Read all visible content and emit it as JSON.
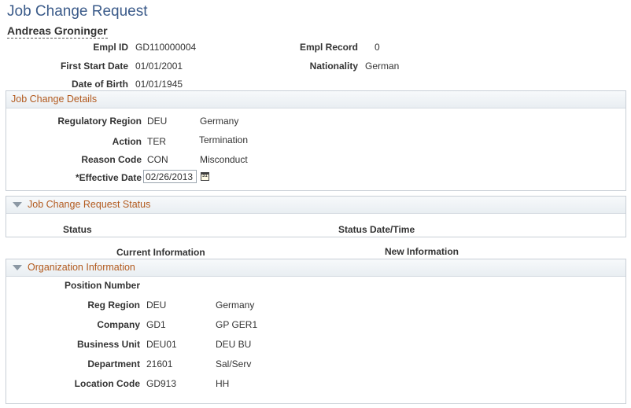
{
  "page": {
    "title": "Job Change Request",
    "person_name": "Andreas Groninger"
  },
  "employee": {
    "empl_id_label": "Empl ID",
    "empl_id": "GD110000004",
    "empl_record_label": "Empl Record",
    "empl_record": "0",
    "first_start_label": "First Start Date",
    "first_start": "01/01/2001",
    "nationality_label": "Nationality",
    "nationality": "German",
    "dob_label": "Date of Birth",
    "dob": "01/01/1945"
  },
  "job_change": {
    "title": "Job Change Details",
    "reg_region_label": "Regulatory Region",
    "reg_region_code": "DEU",
    "reg_region_desc": "Germany",
    "action_label": "Action",
    "action_code": "TER",
    "action_desc": "Termination",
    "reason_label": "Reason Code",
    "reason_code": "CON",
    "reason_desc": "Misconduct",
    "effective_label": "*Effective Date",
    "effective_date": "02/26/2013"
  },
  "status_section": {
    "title": "Job Change Request Status",
    "status_col": "Status",
    "status_date_col": "Status Date/Time"
  },
  "info_headers": {
    "current": "Current Information",
    "new": "New Information"
  },
  "org": {
    "title": "Organization Information",
    "position_label": "Position Number",
    "rows": [
      {
        "label": "Reg Region",
        "code": "DEU",
        "desc": "Germany"
      },
      {
        "label": "Company",
        "code": "GD1",
        "desc": "GP GER1"
      },
      {
        "label": "Business Unit",
        "code": "DEU01",
        "desc": "DEU BU"
      },
      {
        "label": "Department",
        "code": "21601",
        "desc": "Sal/Serv"
      },
      {
        "label": "Location Code",
        "code": "GD913",
        "desc": "HH"
      }
    ]
  },
  "colors": {
    "title_blue": "#3b5b8a",
    "section_orange": "#b25a1e",
    "border": "#c8cfd6"
  }
}
